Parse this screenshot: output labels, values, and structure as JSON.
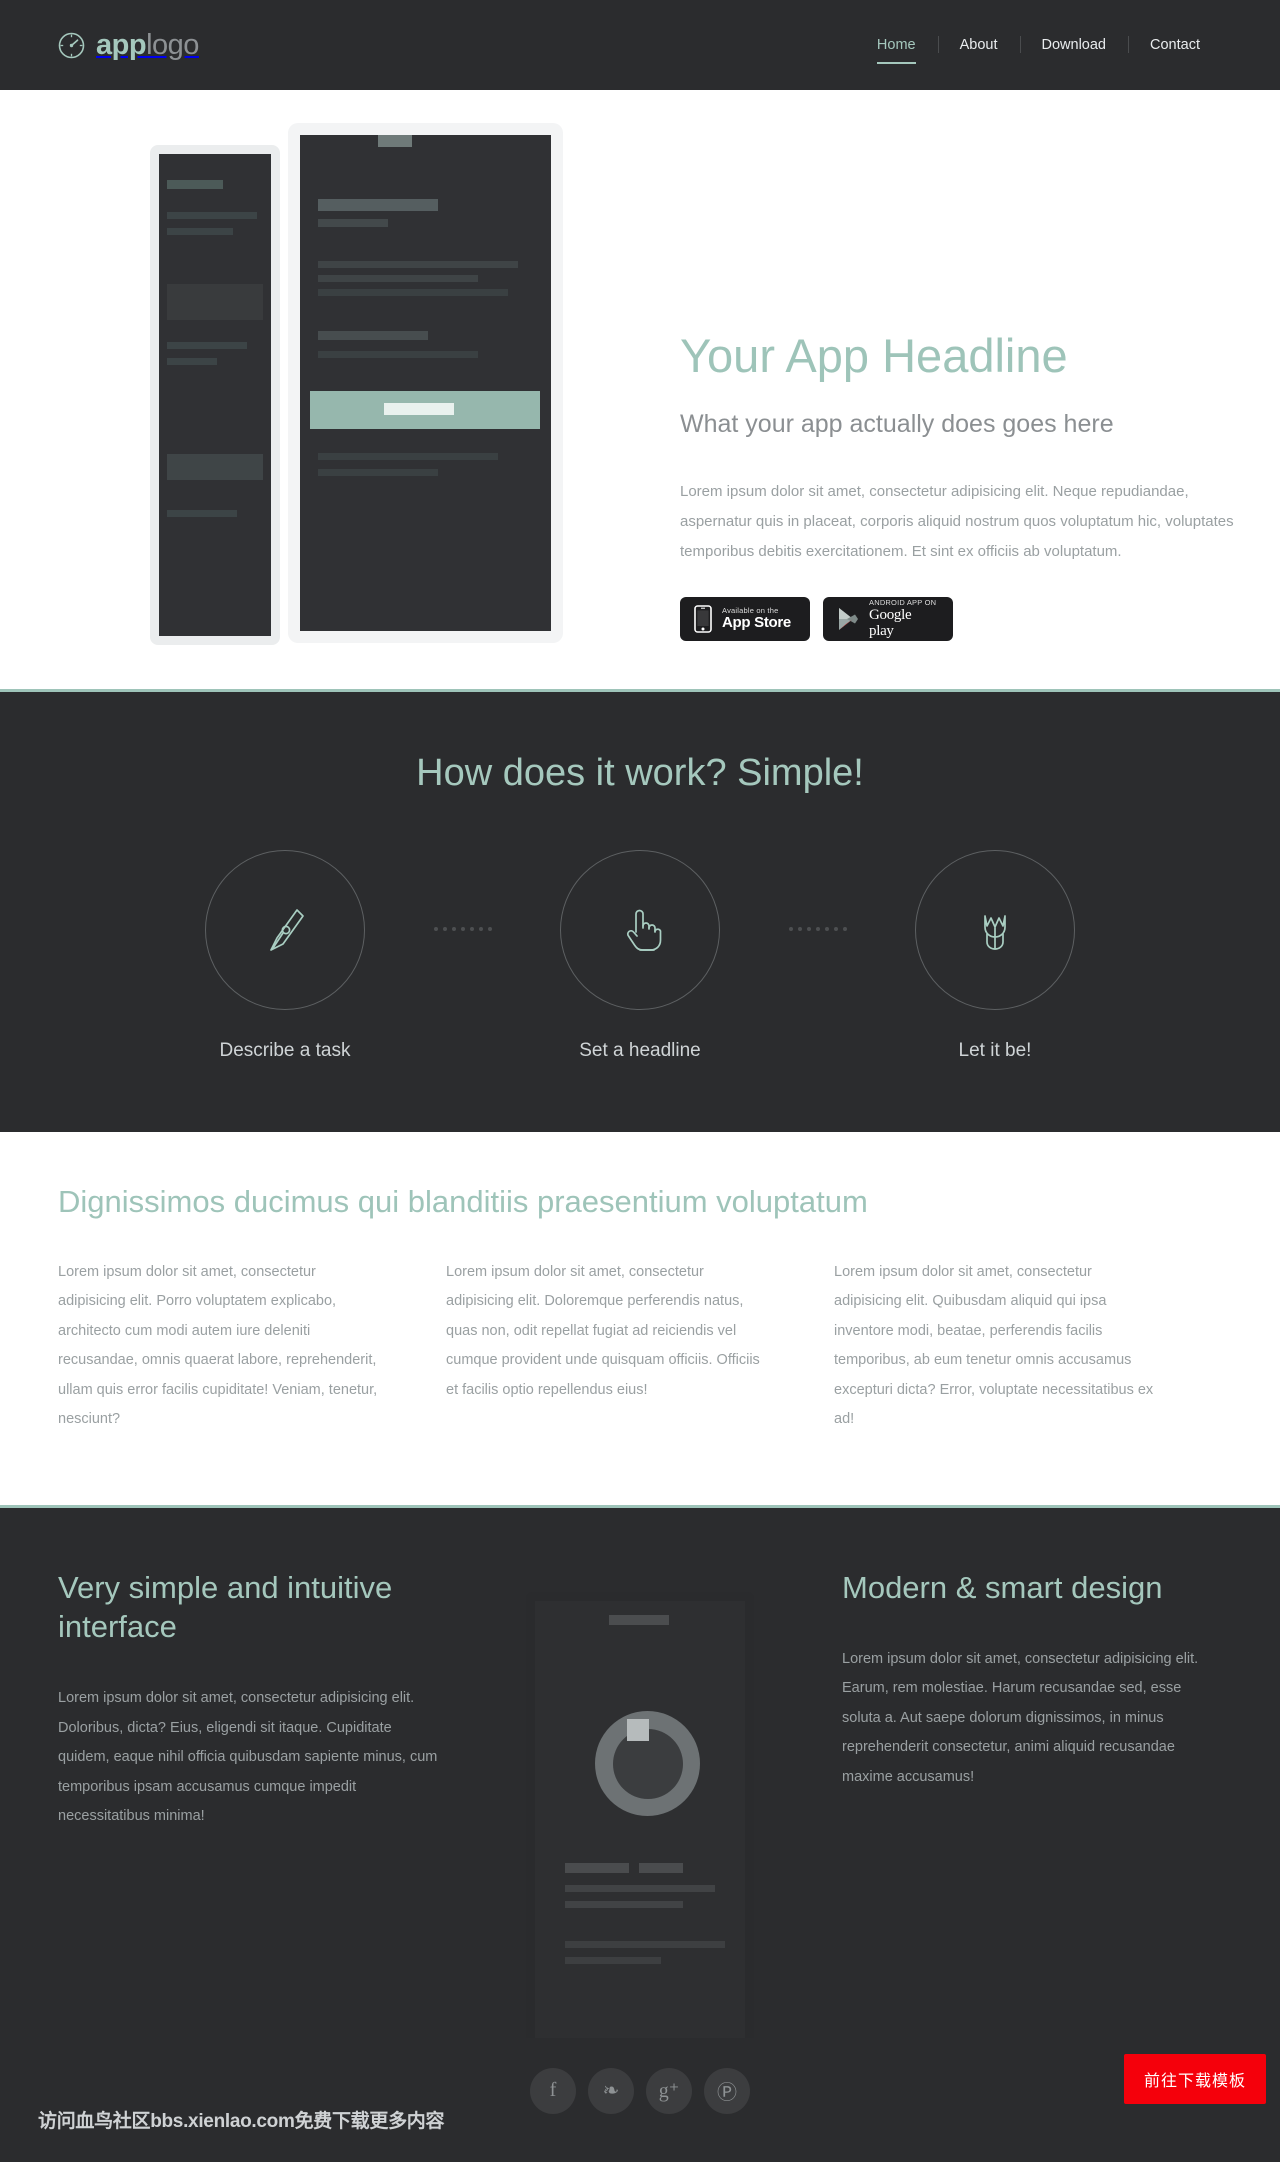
{
  "header": {
    "logo": {
      "icon": "speedometer-icon",
      "bold_part": "app",
      "light_part": "logo"
    },
    "nav": [
      {
        "label": "Home",
        "active": true
      },
      {
        "label": "About",
        "active": false
      },
      {
        "label": "Download",
        "active": false
      },
      {
        "label": "Contact",
        "active": false
      }
    ]
  },
  "hero": {
    "title": "Your App Headline",
    "subtitle": "What your app actually does goes here",
    "body": "Lorem ipsum dolor sit amet, consectetur adipisicing elit. Neque repudiandae, aspernatur quis in placeat, corporis aliquid nostrum quos voluptatum hic, voluptates temporibus debitis exercitationem. Et sint ex officiis ab voluptatum.",
    "badges": [
      {
        "icon": "iphone-icon",
        "small": "Available on the",
        "big": "App Store"
      },
      {
        "icon": "google-play-icon",
        "small": "ANDROID APP ON",
        "big": "Google play"
      }
    ]
  },
  "how": {
    "title": "How does it work? Simple!",
    "steps": [
      {
        "icon": "pen-nib-icon",
        "label": "Describe a task"
      },
      {
        "icon": "pointing-hand-icon",
        "label": "Set a headline"
      },
      {
        "icon": "tulip-flower-icon",
        "label": "Let it be!"
      }
    ]
  },
  "features": {
    "title": "Dignissimos ducimus qui blanditiis praesentium voluptatum",
    "columns": [
      "Lorem ipsum dolor sit amet, consectetur adipisicing elit. Porro voluptatem explicabo, architecto cum modi autem iure deleniti recusandae, omnis quaerat labore, reprehenderit, ullam quis error facilis cupiditate! Veniam, tenetur, nesciunt?",
      "Lorem ipsum dolor sit amet, consectetur adipisicing elit. Doloremque perferendis natus, quas non, odit repellat fugiat ad reiciendis vel cumque provident unde quisquam officiis. Officiis et facilis optio repellendus eius!",
      "Lorem ipsum dolor sit amet, consectetur adipisicing elit. Quibusdam aliquid qui ipsa inventore modi, beatae, perferendis facilis temporibus, ab eum tenetur omnis accusamus excepturi dicta? Error, voluptate necessitatibus ex ad!"
    ]
  },
  "split": {
    "left": {
      "title": "Very simple and intuitive interface",
      "body": "Lorem ipsum dolor sit amet, consectetur adipisicing elit. Doloribus, dicta? Eius, eligendi sit itaque. Cupiditate quidem, eaque nihil officia quibusdam sapiente minus, cum temporibus ipsam accusamus cumque impedit necessitatibus minima!"
    },
    "right": {
      "title": "Modern & smart design",
      "body": "Lorem ipsum dolor sit amet, consectetur adipisicing elit. Earum, rem molestiae. Harum recusandae sed, esse soluta a. Aut saepe dolorum dignissimos, in minus reprehenderit consectetur, animi aliquid recusandae maxime accusamus!"
    }
  },
  "footer": {
    "socials": [
      {
        "icon": "facebook-icon",
        "glyph": "f"
      },
      {
        "icon": "twitter-icon",
        "glyph": "❧"
      },
      {
        "icon": "google-plus-icon",
        "glyph": "g⁺"
      },
      {
        "icon": "pinterest-icon",
        "glyph": "Ⓟ"
      }
    ],
    "watermark": "访问血鸟社区bbs.xienlao.com免费下载更多内容",
    "cta_label": "前往下载模板"
  },
  "colors": {
    "mint": "#9ec4b9",
    "dark": "#2b2c2e",
    "body_gray": "#9aa0a2",
    "cta_red": "#f5000b"
  }
}
